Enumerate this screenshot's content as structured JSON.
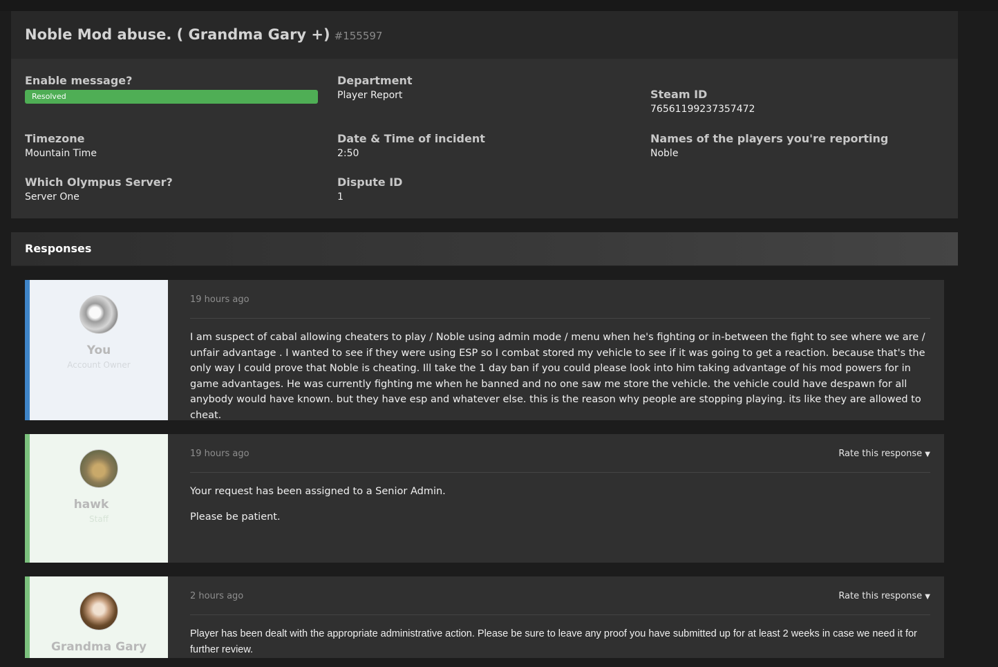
{
  "ticket": {
    "title": "Noble Mod abuse. ( Grandma Gary +)",
    "id": "#155597"
  },
  "fields": {
    "enable_message": {
      "label": "Enable message?",
      "value": "Resolved"
    },
    "department": {
      "label": "Department",
      "value": "Player Report"
    },
    "steam_id": {
      "label": "Steam ID",
      "value": "76561199237357472"
    },
    "timezone": {
      "label": "Timezone",
      "value": "Mountain Time"
    },
    "incident_time": {
      "label": "Date & Time of incident",
      "value": "2:50"
    },
    "players_reported": {
      "label": "Names of the players you're reporting",
      "value": "Noble"
    },
    "server": {
      "label": "Which Olympus Server?",
      "value": "Server One"
    },
    "dispute_id": {
      "label": "Dispute ID",
      "value": "1"
    }
  },
  "responses_title": "Responses",
  "rate_label": "Rate this response",
  "responses": [
    {
      "author": "You",
      "role": "Account Owner",
      "time": "19 hours ago",
      "paragraphs": [
        "I am suspect of cabal allowing cheaters to play / Noble using admin mode / menu when he's fighting or in-between the fight to see where we are / unfair advantage . I wanted to see if they were using ESP so I combat stored my vehicle to see if it was going to get a reaction. because that's the only way I could prove that Noble is cheating. Ill take the 1 day ban if you could please look into him taking advantage of his mod powers for in game advantages. He was currently fighting me when he banned and no one saw me store the vehicle. the vehicle could have despawn for all anybody would have known. but they have esp and whatever else. this is the reason why people are stopping playing. its like they are allowed to cheat."
      ]
    },
    {
      "author": "hawk",
      "role": "Staff",
      "time": "19 hours ago",
      "paragraphs": [
        "Your request has been assigned to a Senior Admin.",
        "Please be patient."
      ]
    },
    {
      "author": "Grandma Gary",
      "role": "",
      "time": "2 hours ago",
      "paragraphs": [
        "Player has been dealt with the appropriate administrative action. Please be sure to leave any proof you have submitted up for at least 2 weeks in case we need it for further review."
      ]
    }
  ],
  "colors": {
    "resolved": "#4fae55",
    "owner_accent": "#3f85c8",
    "staff_accent": "#7cc27e"
  }
}
